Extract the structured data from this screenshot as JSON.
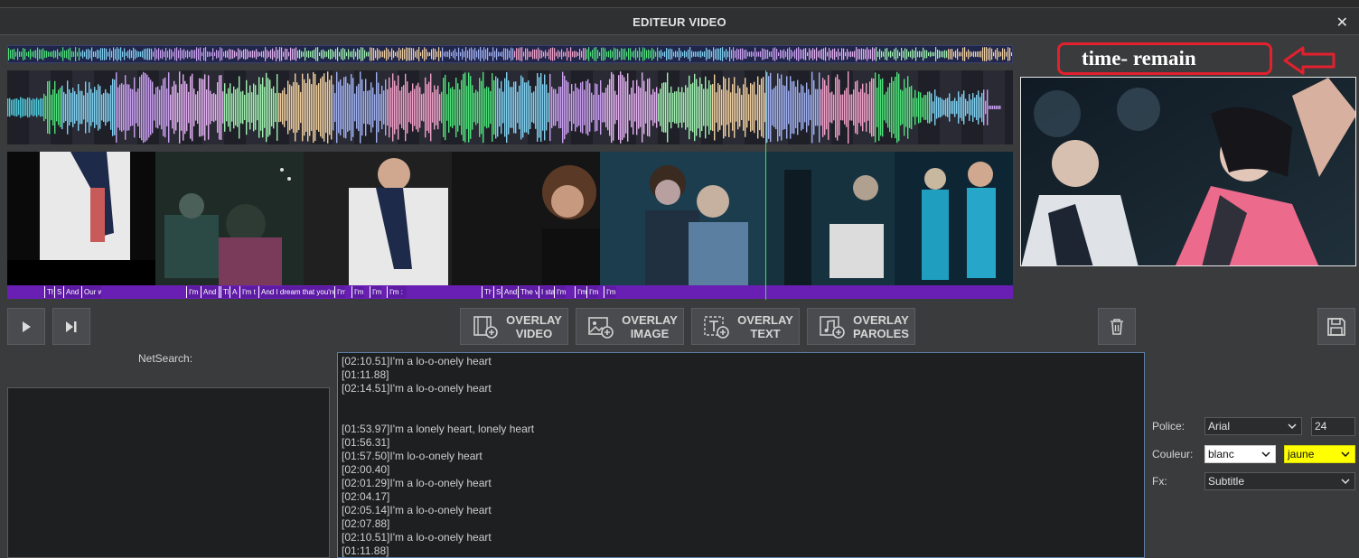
{
  "window": {
    "title": "EDITEUR VIDEO",
    "close_symbol": "✕"
  },
  "annotation": {
    "text": "time- remain",
    "color": "#e3202e"
  },
  "timeline": {
    "lyric_chunks": [
      "Th",
      "S",
      "And",
      "Our w",
      "I'm",
      "And",
      "I",
      "Th",
      "Ar",
      "I'm t",
      "And I dream that you're",
      "I'm",
      "I'm",
      "I'm",
      "I'm :",
      "Th",
      "S",
      "And",
      "The v",
      "I sta",
      "I'm",
      "I'm",
      "I'm",
      "I'm a lo-o-onely heart"
    ],
    "playhead_color": "#3fe060",
    "lyrics_track_color": "#6a1fb4"
  },
  "toolbar": {
    "play_icon": "play-icon",
    "skip_icon": "skip-forward-icon",
    "overlay_video": [
      "OVERLAY",
      "VIDEO"
    ],
    "overlay_image": [
      "OVERLAY",
      "IMAGE"
    ],
    "overlay_text": [
      "OVERLAY",
      "TEXT"
    ],
    "overlay_paroles": [
      "OVERLAY",
      "PAROLES"
    ],
    "delete_icon": "trash-icon",
    "save_icon": "save-icon"
  },
  "netsearch": {
    "label": "NetSearch:"
  },
  "lyrics_editor": {
    "lines": [
      "[02:10.51]I'm a lo-o-onely heart",
      "[01:11.88]",
      "[02:14.51]I'm a lo-o-onely heart",
      "",
      "",
      "[01:53.97]I'm a lonely heart, lonely heart",
      "[01:56.31]",
      "[01:57.50]I'm lo-o-onely heart",
      "[02:00.40]",
      "[02:01.29]I'm a lo-o-onely heart",
      "[02:04.17]",
      "[02:05.14]I'm a lo-o-onely heart",
      "[02:07.88]",
      "[02:10.51]I'm a lo-o-onely heart",
      "[01:11.88]"
    ]
  },
  "properties": {
    "police_label": "Police:",
    "police_value": "Arial",
    "size_value": "24",
    "couleur_label": "Couleur:",
    "couleur_1": "blanc",
    "couleur_2": "jaune",
    "fx_label": "Fx:",
    "fx_value": "Subtitle"
  }
}
